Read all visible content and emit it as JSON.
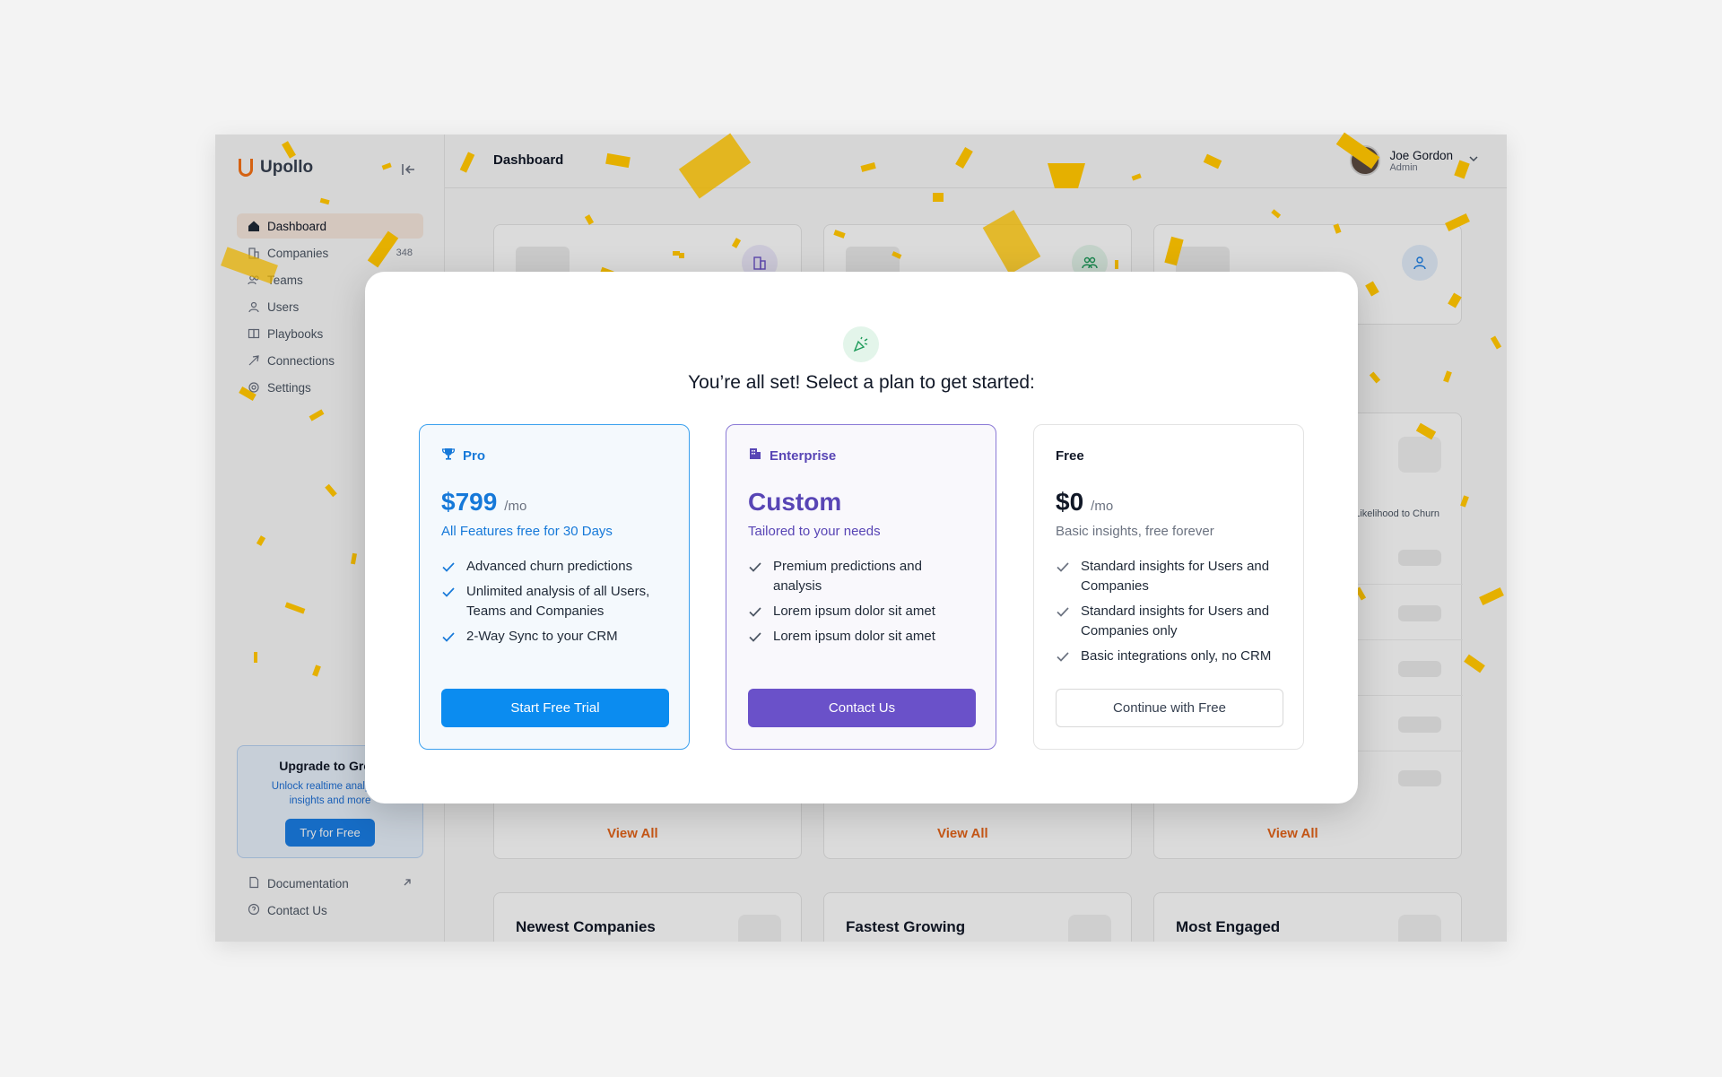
{
  "app": {
    "brand": "Upollo",
    "nav": [
      {
        "label": "Dashboard",
        "icon": "home-icon",
        "active": true
      },
      {
        "label": "Companies",
        "icon": "building-icon",
        "count": "348"
      },
      {
        "label": "Teams",
        "icon": "users-icon"
      },
      {
        "label": "Users",
        "icon": "user-icon"
      },
      {
        "label": "Playbooks",
        "icon": "book-icon"
      },
      {
        "label": "Connections",
        "icon": "rocket-icon"
      },
      {
        "label": "Settings",
        "icon": "gear-icon"
      }
    ],
    "upgrade": {
      "title": "Upgrade to Grow",
      "text": "Unlock realtime analytics, insights and more",
      "button": "Try for Free"
    },
    "footer_links": [
      {
        "label": "Documentation",
        "icon": "doc-icon"
      },
      {
        "label": "Contact Us",
        "icon": "help-icon"
      }
    ],
    "topbar": {
      "title": "Dashboard",
      "user_name": "Joe Gordon",
      "user_role": "Admin"
    },
    "churn_label": "Likelihood to Churn",
    "view_all": [
      "View All",
      "View All",
      "View All"
    ],
    "sections": [
      "Newest Companies",
      "Fastest Growing",
      "Most Engaged"
    ]
  },
  "modal": {
    "title": "You’re all set! Select a plan to get started:",
    "plans": [
      {
        "name": "Pro",
        "icon": "trophy-icon",
        "price": "$799",
        "per": "/mo",
        "subtitle": "All Features free for 30 Days",
        "features": [
          "Advanced churn predictions",
          "Unlimited analysis of all Users, Teams and Companies",
          "2-Way Sync to your CRM"
        ],
        "button": "Start Free Trial"
      },
      {
        "name": "Enterprise",
        "icon": "building-icon",
        "price": "Custom",
        "subtitle": "Tailored to your needs",
        "features": [
          "Premium predictions and analysis",
          "Lorem ipsum dolor sit amet",
          "Lorem ipsum dolor sit amet"
        ],
        "button": "Contact Us"
      },
      {
        "name": "Free",
        "price": "$0",
        "per": "/mo",
        "subtitle": "Basic insights, free forever",
        "features": [
          "Standard insights for Users and Companies",
          "Standard insights for Users and Companies only",
          "Basic integrations only, no CRM"
        ],
        "button": "Continue with Free"
      }
    ]
  },
  "colors": {
    "accent_orange": "#e8661a",
    "pro_blue": "#0b8cf0",
    "enterprise_purple": "#6a51c9",
    "confetti_gold": "#e5b000"
  }
}
